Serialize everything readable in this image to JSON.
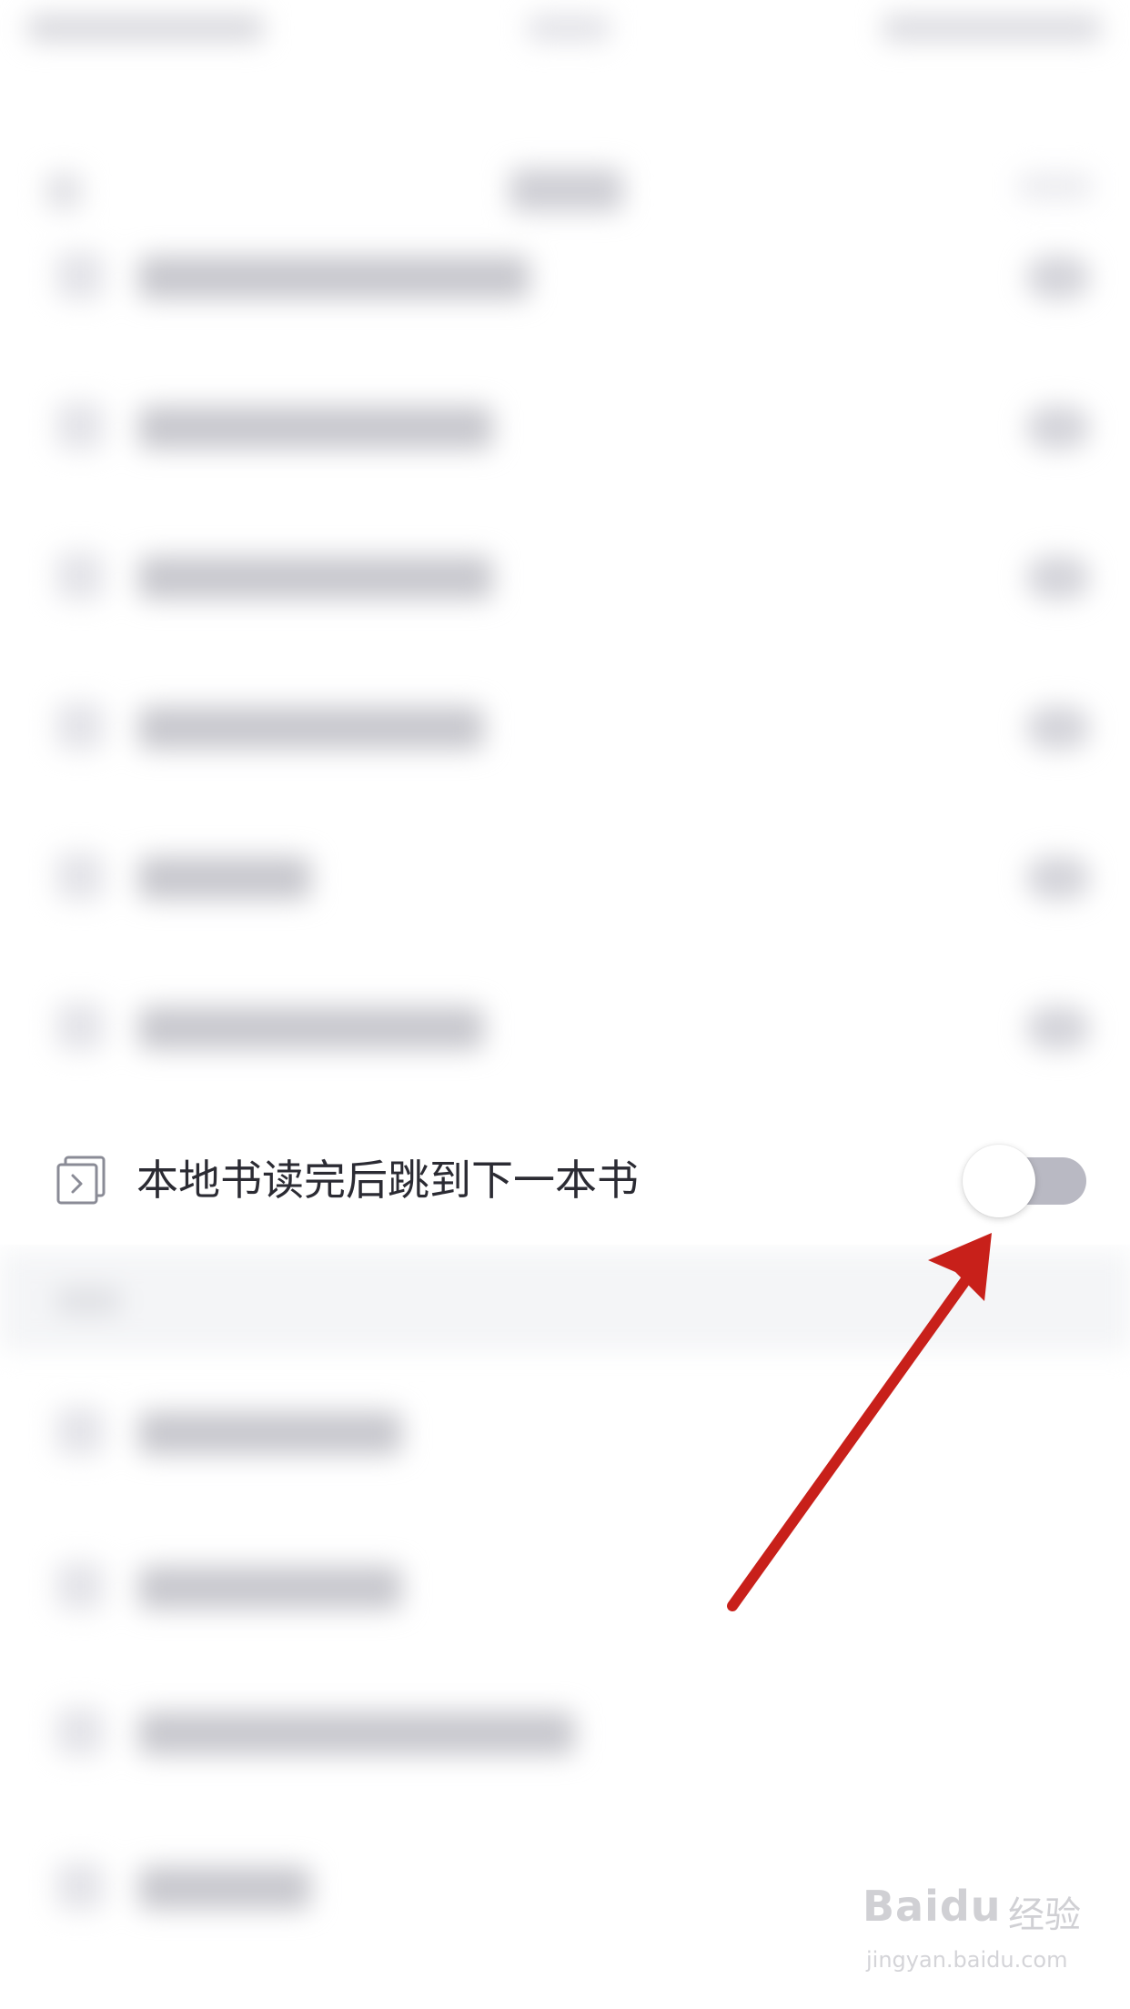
{
  "setting": {
    "label": "本地书读完后跳到下一本书",
    "icon": "next-book-icon",
    "toggle_state": "off"
  },
  "colors": {
    "toggle_track_off": "#b9b9c3",
    "annotation_arrow": "#c8201a",
    "section_background": "#f4f5f7"
  },
  "watermark": {
    "brand": "Baidu",
    "suffix": "经验",
    "url": "jingyan.baidu.com"
  }
}
